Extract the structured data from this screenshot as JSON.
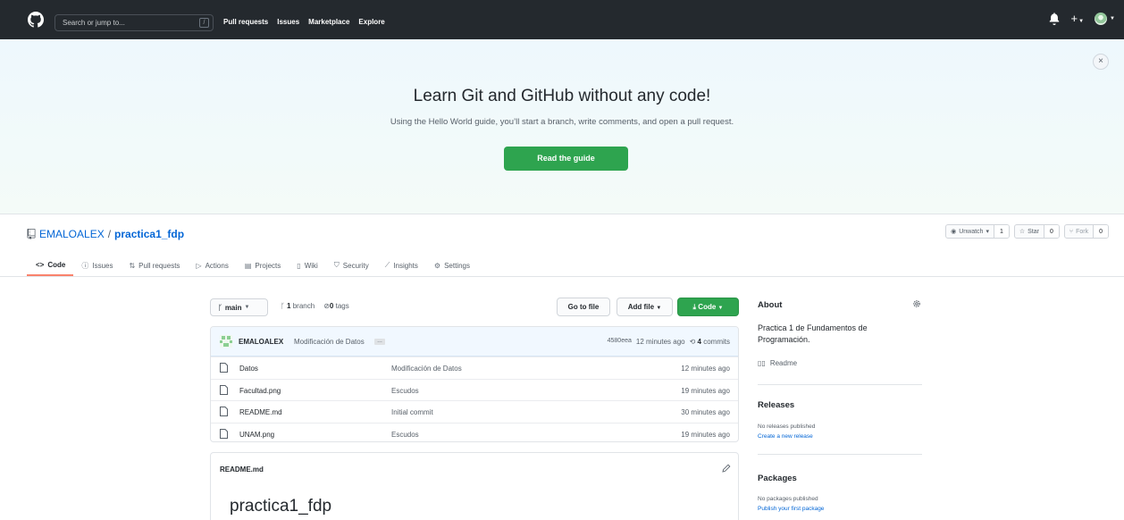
{
  "topnav": {
    "search_placeholder": "Search or jump to...",
    "slash_key": "/",
    "links": [
      "Pull requests",
      "Issues",
      "Marketplace",
      "Explore"
    ]
  },
  "banner": {
    "title": "Learn Git and GitHub without any code!",
    "subtitle": "Using the Hello World guide, you’ll start a branch, write comments, and open a pull request.",
    "button": "Read the guide",
    "close": "×"
  },
  "repo": {
    "owner": "EMALOALEX",
    "separator": "/",
    "name": "practica1_fdp",
    "unwatch_label": "Unwatch",
    "unwatch_count": "1",
    "star_label": "Star",
    "star_count": "0",
    "fork_label": "Fork",
    "fork_count": "0"
  },
  "tabs": [
    {
      "label": "Code",
      "icon": "<>"
    },
    {
      "label": "Issues",
      "icon": "ⓘ"
    },
    {
      "label": "Pull requests",
      "icon": "⇅"
    },
    {
      "label": "Actions",
      "icon": "▷"
    },
    {
      "label": "Projects",
      "icon": "▤"
    },
    {
      "label": "Wiki",
      "icon": "▯"
    },
    {
      "label": "Security",
      "icon": "⛉"
    },
    {
      "label": "Insights",
      "icon": "⟋"
    },
    {
      "label": "Settings",
      "icon": "⚙"
    }
  ],
  "branch": {
    "current": "main",
    "branches_count": "1",
    "branches_label": "branch",
    "tags_count": "0",
    "tags_label": "tags"
  },
  "buttons": {
    "goto_file": "Go to file",
    "add_file": "Add file",
    "code": "Code"
  },
  "commit": {
    "author": "EMALOALEX",
    "message": "Modificación de Datos",
    "sha": "4580eea",
    "time": "12 minutes ago",
    "commits_count": "4",
    "commits_label": "commits"
  },
  "files": [
    {
      "name": "Datos",
      "commit": "Modificación de Datos",
      "age": "12 minutes ago"
    },
    {
      "name": "Facultad.png",
      "commit": "Escudos",
      "age": "19 minutes ago"
    },
    {
      "name": "README.md",
      "commit": "Initial commit",
      "age": "30 minutes ago"
    },
    {
      "name": "UNAM.png",
      "commit": "Escudos",
      "age": "19 minutes ago"
    }
  ],
  "readme": {
    "filename": "README.md",
    "heading": "practica1_fdp"
  },
  "sidebar": {
    "about_title": "About",
    "description": "Practica 1 de Fundamentos de Programación.",
    "readme_link": "Readme",
    "releases_title": "Releases",
    "releases_none": "No releases published",
    "releases_create": "Create a new release",
    "packages_title": "Packages",
    "packages_none": "No packages published",
    "packages_publish": "Publish your first package"
  },
  "colors": {
    "nav_bg": "#24292e",
    "green": "#2ea44f",
    "link_blue": "#0366d6",
    "tab_underline": "#f9826c"
  }
}
